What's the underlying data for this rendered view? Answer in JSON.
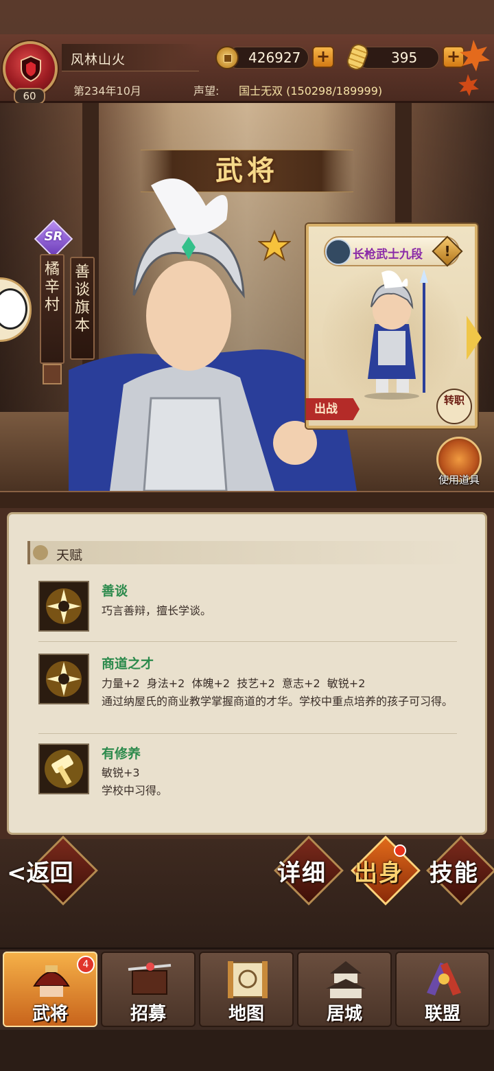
{
  "header": {
    "player_name": "风林山火",
    "level": "60",
    "date": "第234年10月",
    "prestige_label": "声望:",
    "prestige_value": "国士无双 (150298/189999)",
    "copper": "426927",
    "gold": "395",
    "copper_icon": "coin-icon",
    "gold_icon": "gold-bar-icon",
    "plus_label": "+"
  },
  "page": {
    "title": "武将"
  },
  "hero": {
    "rarity": "SR",
    "name": "橘辛村",
    "title": "善谈旗本",
    "star_icon": "star-icon",
    "unit_name": "长枪武士九段",
    "unit_warn": "!",
    "deploy": "出战",
    "switch_job": "转职",
    "use_item": "使用道具"
  },
  "talents": {
    "section_title": "天赋",
    "items": [
      {
        "name": "善谈",
        "desc": "巧言善辩，擅长学谈。",
        "icon": "sun-burst-icon"
      },
      {
        "name": "商道之才",
        "desc": "力量+2  身法+2  体魄+2  技艺+2  意志+2  敏锐+2",
        "desc2": "通过纳屋氏的商业教学掌握商道的才华。学校中重点培养的孩子可习得。",
        "icon": "sun-burst-icon"
      },
      {
        "name": "有修养",
        "desc": "敏锐+3",
        "desc2": "学校中习得。",
        "icon": "hammer-glow-icon"
      }
    ]
  },
  "actions": {
    "back": "<返回",
    "detail": "详细",
    "origin": "出身",
    "skills": "技能"
  },
  "nav": {
    "items": [
      {
        "label": "武将",
        "icon": "samurai-helmet-icon",
        "badge": "4"
      },
      {
        "label": "招募",
        "icon": "katana-icon"
      },
      {
        "label": "地图",
        "icon": "scroll-map-icon"
      },
      {
        "label": "居城",
        "icon": "castle-icon"
      },
      {
        "label": "联盟",
        "icon": "alliance-banner-icon"
      }
    ]
  },
  "colors": {
    "accent_gold": "#f6d98a",
    "talent_green": "#2c8a4c",
    "unit_purple": "#8a2aa8",
    "deploy_red": "#b42b28"
  }
}
